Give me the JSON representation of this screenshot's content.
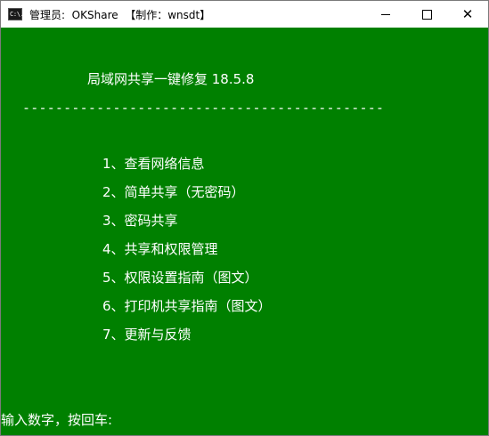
{
  "window": {
    "icon_label": "C:\\.",
    "title": "管理员:  OKShare  【制作：wnsdt】"
  },
  "controls": {
    "minimize": "minimize-icon",
    "maximize": "maximize-icon",
    "close": "close-icon",
    "close_glyph": "✕"
  },
  "colors": {
    "console_bg": "#008000",
    "console_text": "#ffffff",
    "titlebar_bg": "#ffffff"
  },
  "console": {
    "app_title": "局域网共享一键修复 18.5.8",
    "separator": "--------------------------------------------",
    "menu": [
      "1、查看网络信息",
      "2、简单共享（无密码）",
      "3、密码共享",
      "4、共享和权限管理",
      "5、权限设置指南（图文）",
      "6、打印机共享指南（图文）",
      "7、更新与反馈"
    ],
    "prompt": "输入数字，按回车:"
  }
}
